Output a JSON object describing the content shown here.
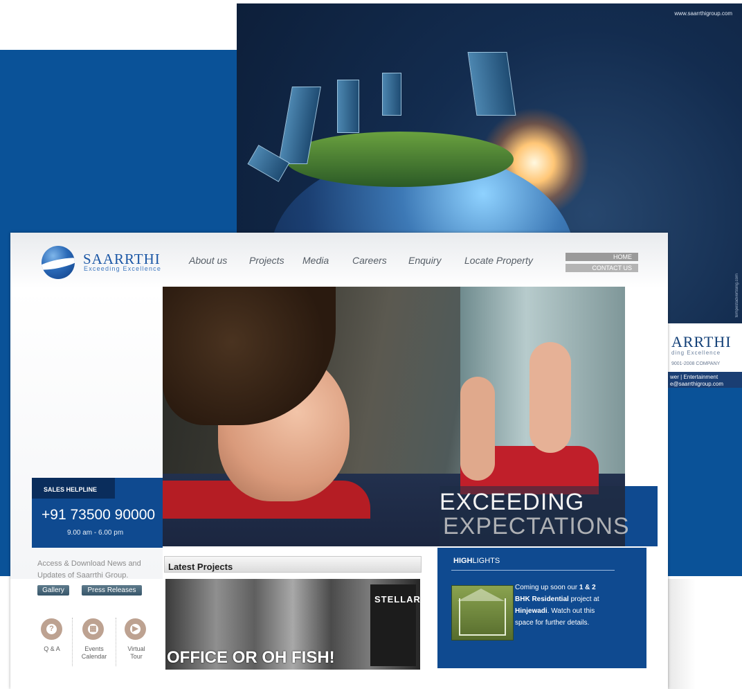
{
  "ad": {
    "url": "www.saarrthigroup.com",
    "side_text": "tempestadvertising.com",
    "logo_text": "ARRTHI",
    "logo_tag": "ding Excellence",
    "iso": "9001-2008 COMPANY",
    "strip_line_1": "wer | Entertainment",
    "strip_line_2": "e@saarrthigroup.com"
  },
  "site": {
    "logo": {
      "name": "SAARRTHI",
      "tagline": "Exceeding Excellence"
    },
    "nav": [
      "About us",
      "Projects",
      "Media",
      "Careers",
      "Enquiry",
      "Locate Property"
    ],
    "top_buttons": {
      "home": "HOME",
      "contact": "CONTACT US"
    },
    "hero": {
      "line1": "EXCEEDING",
      "line2": "EXPECTATIONS"
    },
    "helpline": {
      "title": "SALES HELPLINE",
      "number": "+91 73500 90000",
      "hours": "9.00 am - 6.00 pm"
    },
    "news": {
      "text": "Access & Download News and Updates of Saarrthi Group.",
      "gallery": "Gallery",
      "press": "Press Releases"
    },
    "quick_links": [
      {
        "label": "Q & A",
        "glyph": "?"
      },
      {
        "label": "Events Calendar",
        "glyph": "▦"
      },
      {
        "label": "Virtual Tour",
        "glyph": "▶"
      }
    ],
    "projects": {
      "title": "Latest Projects",
      "caption": "OFFICE OR OH FISH!",
      "stellar": "STELLAR"
    },
    "highlights": {
      "title_bold": "HIGH",
      "title_rest": "LIGHTS",
      "text_1": "Coming up soon our ",
      "text_b1": "1 & 2 BHK Residential",
      "text_2": " project at ",
      "text_b2": "Hinjewadi",
      "text_3": ". Watch out this space for further details."
    }
  },
  "colors": {
    "brand_blue": "#0f4a90",
    "deep_blue": "#0a2d5c",
    "accent_gray": "#9a9a9a"
  }
}
